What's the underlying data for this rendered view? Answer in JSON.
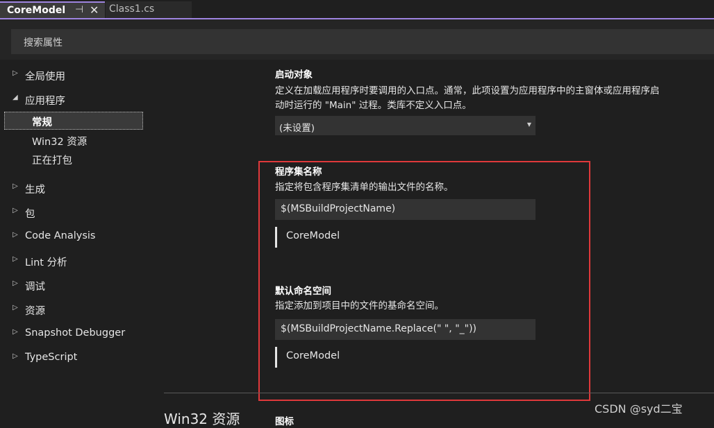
{
  "tabs": [
    {
      "label": "CoreModel",
      "active": true,
      "pin_icon": "pin-icon",
      "close_icon": "close-icon"
    },
    {
      "label": "Class1.cs",
      "active": false
    }
  ],
  "search": {
    "placeholder": "搜索属性"
  },
  "nav": {
    "items": [
      {
        "label": "全局使用",
        "expanded": false
      },
      {
        "label": "应用程序",
        "expanded": true,
        "children": [
          {
            "label": "常规",
            "selected": true
          },
          {
            "label": "Win32 资源"
          },
          {
            "label": "正在打包"
          }
        ]
      },
      {
        "label": "生成",
        "expanded": false
      },
      {
        "label": "包",
        "expanded": false
      },
      {
        "label": "Code Analysis",
        "expanded": false
      },
      {
        "label": "Lint 分析",
        "expanded": false
      },
      {
        "label": "调试",
        "expanded": false
      },
      {
        "label": "资源",
        "expanded": false
      },
      {
        "label": "Snapshot Debugger",
        "expanded": false
      },
      {
        "label": "TypeScript",
        "expanded": false
      }
    ]
  },
  "main": {
    "startup": {
      "title": "启动对象",
      "desc_line1": "定义在加载应用程序时要调用的入口点。通常，此项设置为应用程序中的主窗体或应用程序启",
      "desc_line2": "动时运行的 \"Main\" 过程。类库不定义入口点。",
      "value": "(未设置)"
    },
    "assembly": {
      "title": "程序集名称",
      "desc": "指定将包含程序集清单的输出文件的名称。",
      "value": "$(MSBuildProjectName)",
      "preview": "CoreModel"
    },
    "namespace": {
      "title": "默认命名空间",
      "desc": "指定添加到项目中的文件的基命名空间。",
      "value": "$(MSBuildProjectName.Replace(\" \", \"_\"))",
      "preview": "CoreModel"
    },
    "next_section": {
      "heading": "Win32 资源",
      "sub": "图标"
    }
  },
  "colors": {
    "accent": "#9e84e0",
    "highlight_box": "#e0393b",
    "background": "#1f1f1f"
  },
  "watermark": "CSDN @syd二宝"
}
